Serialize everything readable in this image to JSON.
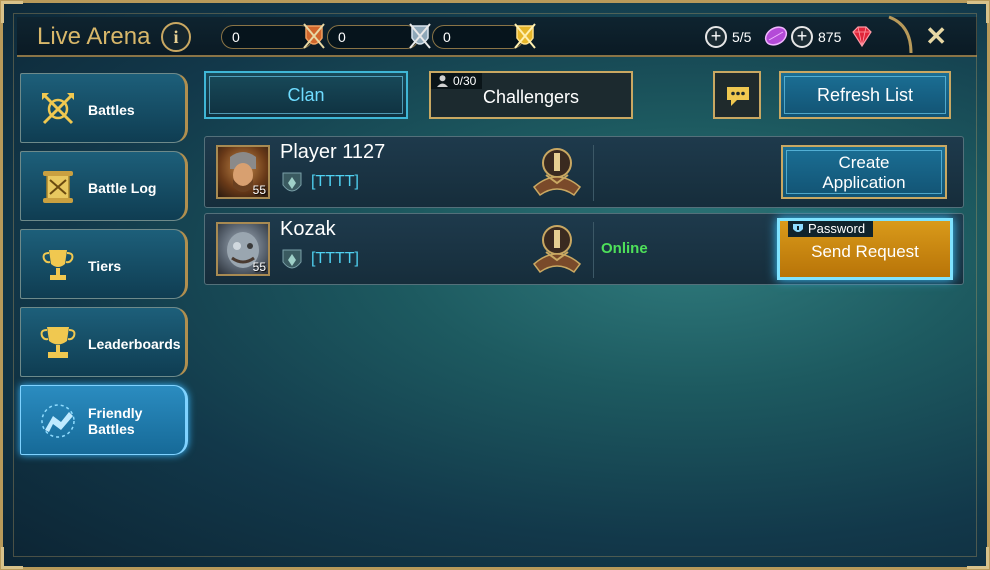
{
  "header": {
    "title": "Live Arena",
    "info_icon": "info-icon",
    "counters": [
      {
        "value": "0",
        "icon": "bronze-medal-icon"
      },
      {
        "value": "0",
        "icon": "silver-medal-icon"
      },
      {
        "value": "0",
        "icon": "gold-medal-icon"
      }
    ],
    "tokens": {
      "value": "5/5",
      "icon": "purple-token-icon"
    },
    "gems": {
      "value": "875",
      "icon": "red-gem-icon"
    }
  },
  "sidebar": {
    "items": [
      {
        "label": "Battles",
        "icon": "crossed-axes-icon"
      },
      {
        "label": "Battle Log",
        "icon": "scroll-icon"
      },
      {
        "label": "Tiers",
        "icon": "trophy-icon"
      },
      {
        "label": "Leaderboards",
        "icon": "double-trophy-icon"
      },
      {
        "label": "Friendly",
        "label2": "Battles",
        "icon": "handshake-icon"
      }
    ],
    "active_index": 4
  },
  "tabs": {
    "clan_label": "Clan",
    "challengers_label": "Challengers",
    "challengers_count": "0/30",
    "refresh_label": "Refresh List"
  },
  "rows": [
    {
      "name": "Player 1127",
      "level": "55",
      "clan_tag": "[TTTT]",
      "status": "",
      "action_line1": "Create",
      "action_line2": "Application"
    },
    {
      "name": "Kozak",
      "level": "55",
      "clan_tag": "[TTTT]",
      "status": "Online",
      "password_label": "Password",
      "action_label": "Send Request"
    }
  ],
  "colors": {
    "gold": "#c9a862",
    "cyan": "#4fd0f0",
    "online_green": "#4ee05a",
    "send_button": "#d99a1a"
  }
}
